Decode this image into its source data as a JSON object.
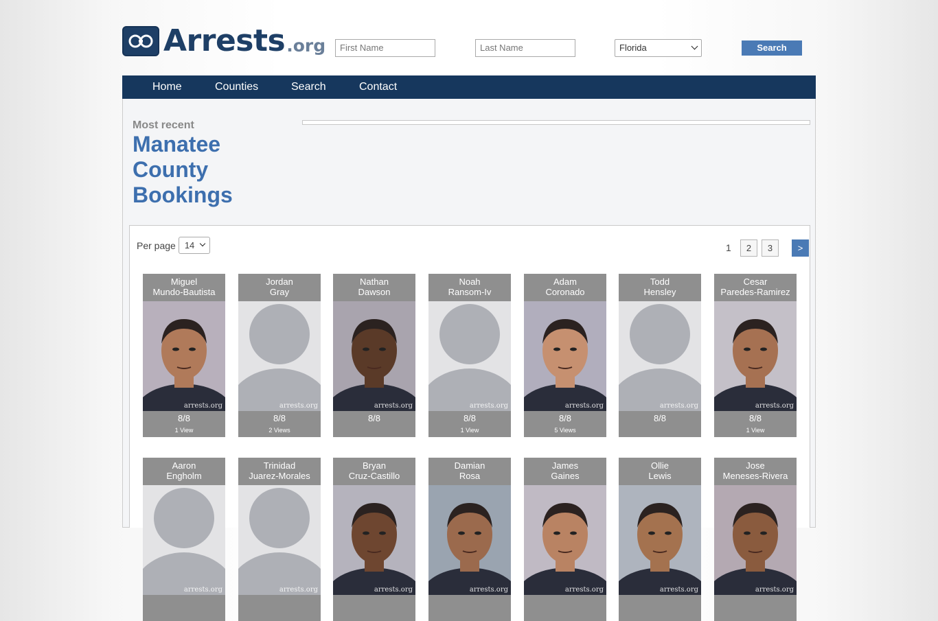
{
  "brand": {
    "name": "Arrests",
    "tld": ".org"
  },
  "search": {
    "first_placeholder": "First Name",
    "last_placeholder": "Last Name",
    "state_selected": "Florida",
    "button_label": "Search"
  },
  "nav": {
    "home": "Home",
    "counties": "Counties",
    "search": "Search",
    "contact": "Contact"
  },
  "page": {
    "subtitle": "Most recent",
    "title": "Manatee County Bookings"
  },
  "per_page": {
    "label": "Per page",
    "value": "14"
  },
  "pagination": {
    "current": "1",
    "pages": [
      "2",
      "3"
    ],
    "next": ">"
  },
  "watermark": "arrests.org",
  "bookings": [
    {
      "first": "Miguel",
      "last": "Mundo-Bautista",
      "date": "8/8",
      "views": "1 View",
      "photo": "mugshot"
    },
    {
      "first": "Jordan",
      "last": "Gray",
      "date": "8/8",
      "views": "2 Views",
      "photo": "placeholder"
    },
    {
      "first": "Nathan",
      "last": "Dawson",
      "date": "8/8",
      "views": "",
      "photo": "mugshot"
    },
    {
      "first": "Noah",
      "last": "Ransom-Iv",
      "date": "8/8",
      "views": "1 View",
      "photo": "placeholder"
    },
    {
      "first": "Adam",
      "last": "Coronado",
      "date": "8/8",
      "views": "5 Views",
      "photo": "mugshot"
    },
    {
      "first": "Todd",
      "last": "Hensley",
      "date": "8/8",
      "views": "",
      "photo": "placeholder"
    },
    {
      "first": "Cesar",
      "last": "Paredes-Ramirez",
      "date": "8/8",
      "views": "1 View",
      "photo": "mugshot"
    },
    {
      "first": "Aaron",
      "last": "Engholm",
      "date": "",
      "views": "",
      "photo": "placeholder"
    },
    {
      "first": "Trinidad",
      "last": "Juarez-Morales",
      "date": "",
      "views": "",
      "photo": "placeholder"
    },
    {
      "first": "Bryan",
      "last": "Cruz-Castillo",
      "date": "",
      "views": "",
      "photo": "mugshot"
    },
    {
      "first": "Damian",
      "last": "Rosa",
      "date": "",
      "views": "",
      "photo": "mugshot"
    },
    {
      "first": "James",
      "last": "Gaines",
      "date": "",
      "views": "",
      "photo": "mugshot"
    },
    {
      "first": "Ollie",
      "last": "Lewis",
      "date": "",
      "views": "",
      "photo": "mugshot"
    },
    {
      "first": "Jose",
      "last": "Meneses-Rivera",
      "date": "",
      "views": "",
      "photo": "mugshot"
    }
  ],
  "colors": {
    "brand_navy": "#1e3f66",
    "nav_bg": "#16375d",
    "accent_blue": "#4a7ab5",
    "title_blue": "#3d6fae",
    "card_gray": "#8f8f8f"
  }
}
